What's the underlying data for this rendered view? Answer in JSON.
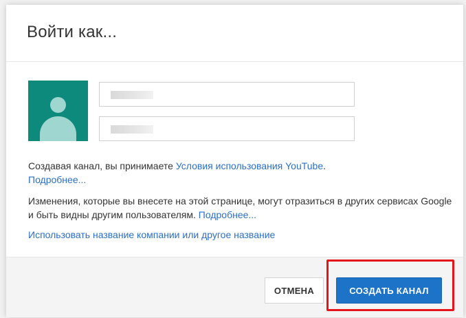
{
  "dialog": {
    "title": "Войти как..."
  },
  "fields": {
    "first_name": {
      "value": "",
      "placeholder": ""
    },
    "last_name": {
      "value": "",
      "placeholder": ""
    }
  },
  "terms": {
    "text_before": "Создавая канал, вы принимаете ",
    "terms_link": "Условия использования YouTube",
    "text_after": ".",
    "more_link": "Подробнее..."
  },
  "notice": {
    "text": "Изменения, которые вы внесете на этой странице, могут отразиться в других сервисах Google и быть видны другим пользователям. ",
    "more_link": "Подробнее..."
  },
  "business_link": "Использовать название компании или другое название",
  "buttons": {
    "cancel": "ОТМЕНА",
    "create": "СОЗДАТЬ КАНАЛ"
  },
  "colors": {
    "avatar_bg": "#0e8a7d",
    "link": "#2a6fc9",
    "primary_button": "#1c73c7",
    "highlight_box": "#e5141b"
  },
  "icons": {
    "avatar": "default-user-avatar-icon"
  }
}
